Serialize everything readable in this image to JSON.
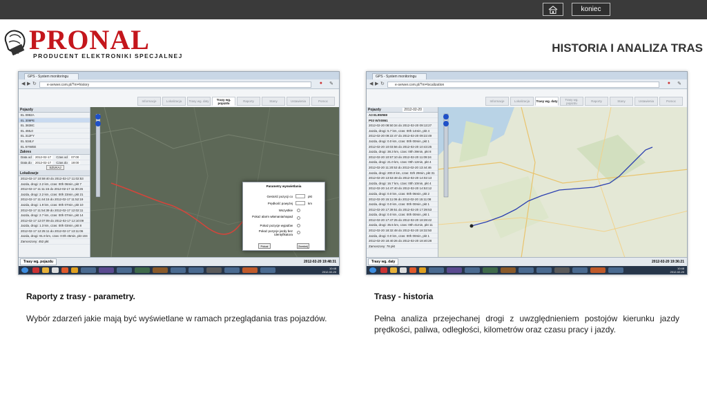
{
  "header": {
    "exit_label": "koniec",
    "page_title": "HISTORIA I ANALIZA TRAS"
  },
  "brand": {
    "name": "PRONAL",
    "tagline": "PRODUCENT ELEKTRONIKI SPECJALNEJ",
    "color": "#c4161c"
  },
  "left_panel": {
    "caption_title": "Raporty z trasy - parametry.",
    "caption_text": "Wybór zdarzeń jakie mają być wyświetlane w ramach przeglądania tras pojazdów.",
    "screenshot": {
      "browser_tab": "GPS - System monitoringu",
      "url": "e-serwer.com.pl/?m=history",
      "nav_tabs": [
        "Informacje",
        "Lokalizacja",
        "Trasy wg. daty",
        "Trasy wg. pojazdu",
        "Raporty",
        "Stany",
        "Ustawienia",
        "Pomoc"
      ],
      "active_tab_index": 3,
      "side_header": "Pojazdy",
      "vehicles": [
        "EL 0992A",
        "EL 309PE",
        "EL 3838C",
        "EL 4ML0",
        "EL 312FY",
        "EL 534LY",
        "EL 6YWEE"
      ],
      "range_header": "Zakres",
      "range_from_label": "Data od",
      "range_from": "2012-02-17",
      "range_to_label": "Data do",
      "range_to": "2012-02-17",
      "time_from_label": "Czas od",
      "time_from": "07:00",
      "time_to_label": "Czas do",
      "time_to": "19:00",
      "search_label": "SZUKAJ",
      "list_header": "Lokalizacje",
      "list_rows": [
        "2012-02-17 10:59:40 do 2012-02-17 11:02:53",
        "Jazda, drogi: 2.2 km, czas: 00h 06min, pkt 7",
        "2012-02-17 11:11:15 do 2012-02-17 11:30:26",
        "Jazda, drogi: 2.2 km, czas: 00h 23min, pkt 21",
        "2012-02-17 11:44:15 do 2012-02-17 11:52:19",
        "Jazda, drogi: 1.9 km, czas: 00h 07min, pkt 10",
        "2012-02-17 11:54:39 do 2012-02-17 12:02:11",
        "Jazda, drogi: 2.7 km, czas: 00h 07min, pkt 14",
        "2012-02-17 12:07:09 do 2012-02-17 12:10:09",
        "Jazda, drogi: 1.3 km, czas: 00h 03min, pkt 8",
        "2012-02-17 12:25:11 do 2012-02-17 13:11:06",
        "Jazda, drogi: 91.8 km, czas: 0:0h 45min, pkt 104"
      ],
      "zoom_label": "Zamoszony: 452 pkt",
      "status_tab": "Trasy wg. pojazdu",
      "status_time": "2012-02-20 19:48:31",
      "dialog": {
        "title": "Parametry wyswietlania",
        "rows": [
          "Gestość pozycji co",
          "Prędkość powyżej",
          "Wszystkie",
          "Pokaż alarm włamania/napad",
          "Pokaż pozycje wyjadów",
          "Pokaż pozycje jazdy bez identyfikatora"
        ],
        "unit_1": "pkt",
        "unit_2": "km",
        "ok_label": "Pokaż",
        "close_label": "Zamknij"
      },
      "clock": "10:48\n2012-02-20"
    }
  },
  "right_panel": {
    "caption_title": "Trasy - historia",
    "caption_text": "Pełna analiza przejechanej drogi z uwzględnieniem postojów kierunku jazdy prędkości, paliwa, odległości, kilometrów oraz czasu pracy i  jazdy.",
    "screenshot": {
      "browser_tab": "GPS - System monitoringu",
      "url": "e-serwer.com.pl/?m=localization",
      "nav_tabs": [
        "Informacje",
        "Lokalizacja",
        "Trasy wg. daty",
        "Trasy wg. pojazdu",
        "Raporty",
        "Stany",
        "Ustawienia",
        "Pomoc"
      ],
      "active_tab_index": 2,
      "side_header": "Pojazdy",
      "side_date": "2012-02-20",
      "vehicle_a": "A3 EL9W969",
      "vehicle_b": "P03 W/X0861",
      "list_rows": [
        "2012-02-20 08:50:34 do 2012-02-20 09:13:27",
        "Jazda, drogi: 5.7 km, czas: 00h 14min, pkt 4",
        "2012-02-20 09:22:47 do 2012-02-20 09:22:49",
        "Jazda, drogi: 0.0 km, czas: 00h 00min, pkt 1",
        "2012-02-20 10:03:56 do 2012-02-20 10:43:25",
        "Jazda, drogi: 38.3 km, czas: 00h 39min, pkt 8",
        "2012-02-20 10:57:10 do 2012-02-20 11:09:24",
        "Jazda, drogi: 21.0 km, czas: 00h 12min, pkt 4",
        "2012-02-20 11:20:53 do 2012-02-20 13:44:46",
        "Jazda, drogi: 200.0 km, czas: 02h 29min, pkt 31",
        "2012-02-20 13:53:48 do 2012-02-20 14:02:13",
        "Jazda, drogi: 16.7 km, czas: 00h 10min, pkt 4",
        "2012-02-20 14:47:40 do 2012-02-20 14:53:12",
        "Jazda, drogi: 0.0 km, czas: 00h 06min, pkt 2",
        "2012-02-20 15:11:06 do 2012-02-20 15:11:08",
        "Jazda, drogi: 0.0 km, czas: 00h 00min, pkt 1",
        "2012-02-20 17:39:51 do 2012-02-20 17:39:53",
        "Jazda, drogi: 0.0 km, czas: 00h 00min, pkt 1",
        "2012-02-20 17:47:25 do 2012-02-20 18:28:42",
        "Jazda, drogi: 35.5 km, czas: 00h 41min, pkt 11",
        "2012-02-20 18:32:48 do 2012-02-20 18:32:50",
        "Jazda, drogi: 0.0 km, czas: 00h 00min, pkt 1",
        "2012-02-20 18:40:26 do 2012-02-20 18:40:28"
      ],
      "zoom_label": "Zamoszony: 78 pkt",
      "status_tab": "Trasy wg. daty",
      "status_time": "2012-02-20 19:36:21",
      "clock": "10:48\n2012-02-20"
    }
  }
}
